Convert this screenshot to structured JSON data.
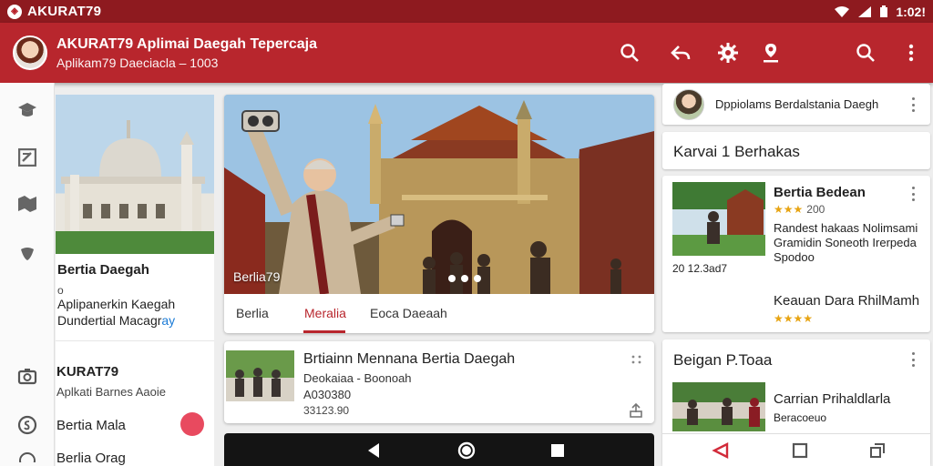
{
  "status_bar": {
    "app_name": "AKURAT79",
    "time": "1:02!"
  },
  "app_bar": {
    "title": "AKURAT79 Aplimai Daegah Tepercaja",
    "subtitle": "Aplikam79 Daeciacla – 1003"
  },
  "left_panel": {
    "feature": {
      "title": "Bertia Daegah",
      "o": "o",
      "desc1": "Aplipanerkin Kaegah",
      "desc2": "Dundertial Macagr",
      "desc2_link": "ay"
    },
    "list": [
      {
        "title": "KURAT79",
        "sub": "Aplkati Barnes Aaoie"
      },
      {
        "title": "Bertia Mala"
      },
      {
        "title": "Berlia Orag"
      }
    ]
  },
  "hero": {
    "caption": "Berlia79",
    "tabs": [
      "Berlia",
      "Meralia",
      "Eoca Daeaah"
    ]
  },
  "news": {
    "title": "Brtiainn Mennana Bertia Daegah",
    "line1": "Deokaiaa - Boonoah",
    "line2": "A030380",
    "line3": "33123.90"
  },
  "right": {
    "card1_text": "Dppiolams Berdalstania Daegh",
    "card2_text": "Karvai 1 Berhakas",
    "card3": {
      "title": "Bertia Bedean",
      "stars": "★★★",
      "rating": "200",
      "line1": "Randest hakaas Nolimsami",
      "line2": "Gramidin Soneoth Irerpeda",
      "line3": "Spodoo",
      "date": "20 12.3ad7",
      "title2": "Keauan Dara RhilMamh",
      "stars2": "★★★★"
    },
    "card4": {
      "title": "Beigan P.Toaa",
      "line1": "Carrian Prihaldlarla",
      "line2": "Beracoeuo"
    }
  },
  "colors": {
    "primary": "#b8262d",
    "status": "#8e1a1f",
    "accent_dot": "#e84a5f"
  }
}
